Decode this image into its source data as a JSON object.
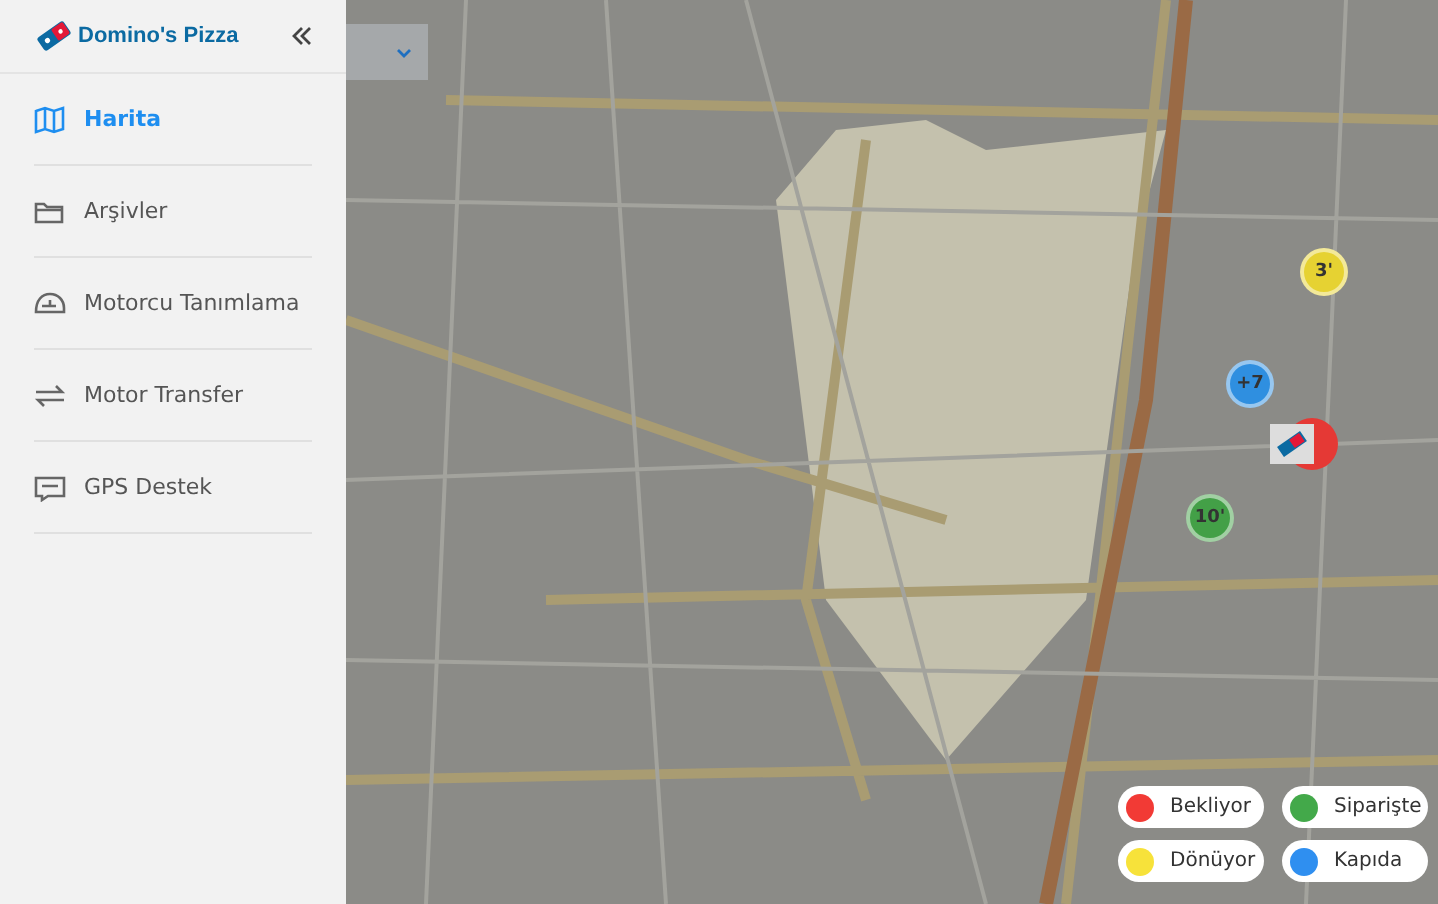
{
  "brand": {
    "name": "Domino's Pizza"
  },
  "sidebar": {
    "items": [
      {
        "label": "Harita",
        "selected": true
      },
      {
        "label": "Arşivler",
        "selected": false
      },
      {
        "label": "Motorcu Tanımlama",
        "selected": false
      },
      {
        "label": "Motor Transfer",
        "selected": false
      },
      {
        "label": "GPS Destek",
        "selected": false
      }
    ]
  },
  "map": {
    "markers": [
      {
        "kind": "cluster",
        "label": "3'",
        "color": "#e6d232"
      },
      {
        "kind": "cluster",
        "label": "+7",
        "color": "#2f8fe0"
      },
      {
        "kind": "cluster",
        "label": "10'",
        "color": "#43a047"
      },
      {
        "kind": "store",
        "color": "#e53935"
      }
    ]
  },
  "legend": [
    {
      "label": "Bekliyor",
      "color": "#f23a35"
    },
    {
      "label": "Siparişte",
      "color": "#43a94a"
    },
    {
      "label": "Dönüyor",
      "color": "#f7e23a"
    },
    {
      "label": "Kapıda",
      "color": "#2f8ff0"
    }
  ]
}
